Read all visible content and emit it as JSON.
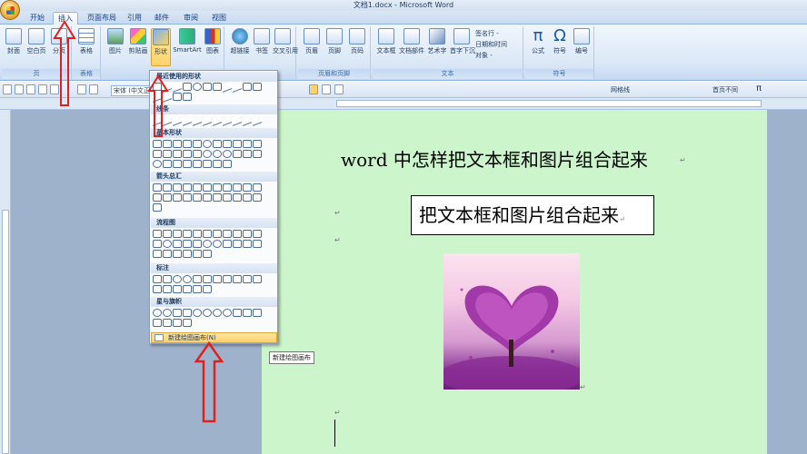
{
  "window": {
    "title": "文档1.docx - Microsoft Word"
  },
  "tabs": [
    {
      "label": "开始",
      "active": false
    },
    {
      "label": "插入",
      "active": true
    },
    {
      "label": "页面布局",
      "active": false
    },
    {
      "label": "引用",
      "active": false
    },
    {
      "label": "邮件",
      "active": false
    },
    {
      "label": "审阅",
      "active": false
    },
    {
      "label": "视图",
      "active": false
    }
  ],
  "ribbon": {
    "buttons": {
      "cover": "封面",
      "blank_page": "空白页",
      "page_break": "分页",
      "table": "表格",
      "picture": "图片",
      "clipart": "剪贴画",
      "shapes": "形状",
      "smartart": "SmartArt",
      "chart": "图表",
      "hyperlink": "超链接",
      "bookmark": "书签",
      "cross_ref": "交叉引用",
      "header": "页眉",
      "footer": "页脚",
      "page_number": "页码",
      "textbox": "文本框",
      "quickparts": "文档部件",
      "wordart": "艺术字",
      "dropcap": "首字下沉",
      "signature_line": "签名行 -",
      "datetime": "日期和时间",
      "object": "对象 -",
      "equation": "公式",
      "symbol": "符号",
      "numbering": "编号"
    },
    "groups": {
      "pages": "页",
      "tables": "表格",
      "headerfooter": "页眉和页脚",
      "text": "文本",
      "symbols": "符号"
    }
  },
  "toolbar": {
    "font_name": "宋体 (中文正",
    "grid_label": "网格线",
    "no_break_label": "首页不同"
  },
  "shapes_menu": {
    "sections": {
      "recent": "最近使用的形状",
      "lines": "线条",
      "basic": "基本形状",
      "arrows": "箭头总汇",
      "flowchart": "流程图",
      "callouts": "标注",
      "stars": "星与旗帜"
    },
    "new_canvas": "新建绘图画布(N)"
  },
  "tooltip": "新建绘图画布",
  "document": {
    "title": "word 中怎样把文本框和图片组合起来",
    "textbox_text": "把文本框和图片组合起来",
    "paragraph_mark": "↵"
  },
  "colors": {
    "page_background": "#ccf5cc",
    "annotation_arrow": "#e02020",
    "ribbon_accent": "#ffd36b"
  }
}
